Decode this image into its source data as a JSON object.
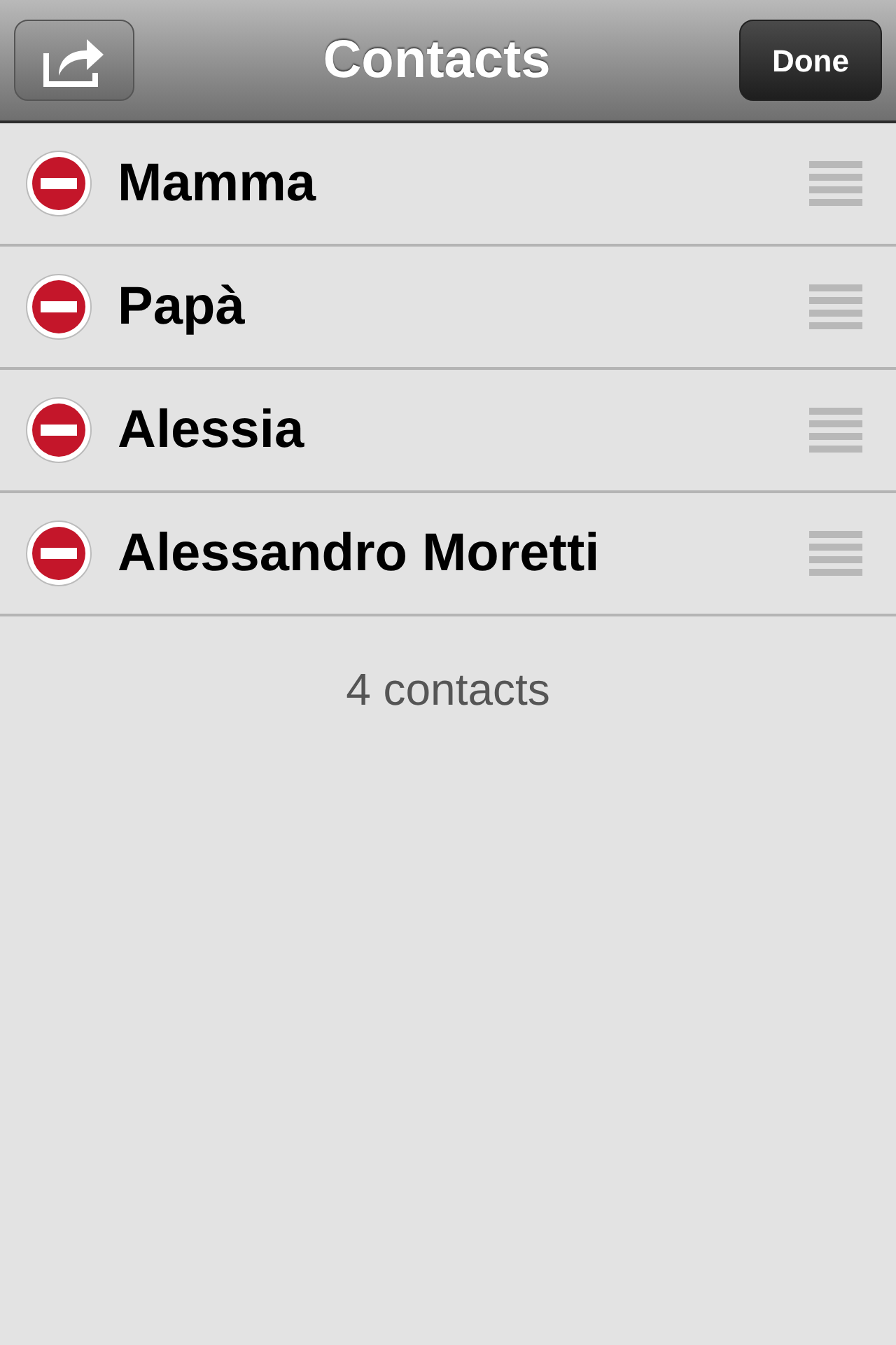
{
  "nav_bar": {
    "title": "Contacts",
    "done_button": "Done"
  },
  "contacts": [
    {
      "name": "Mamma"
    },
    {
      "name": "Papà"
    },
    {
      "name": "Alessia"
    },
    {
      "name": "Alessandro Moretti"
    }
  ],
  "footer": "4 contacts"
}
